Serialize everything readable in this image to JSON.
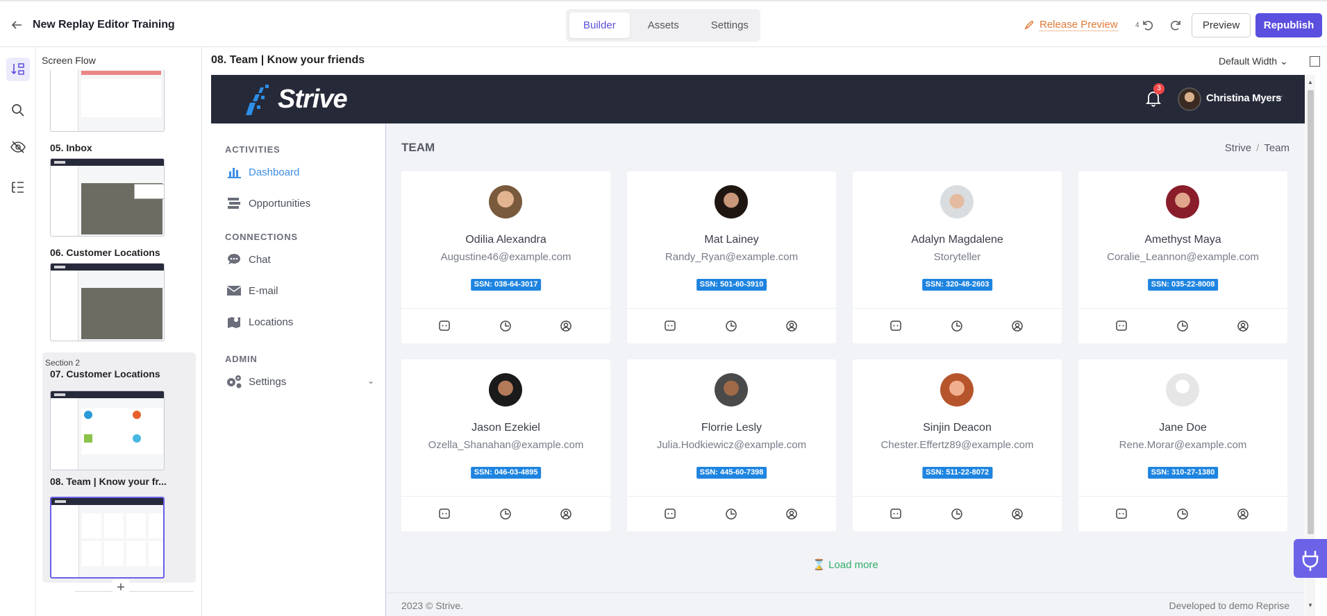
{
  "topbar": {
    "title": "New Replay Editor Training",
    "tabs": [
      "Builder",
      "Assets",
      "Settings"
    ],
    "active_tab": "Builder",
    "release_preview": "Release Preview",
    "undo_count": "4",
    "preview": "Preview",
    "republish": "Republish"
  },
  "flow": {
    "title": "Screen Flow",
    "steps": [
      {
        "label": "05. Inbox"
      },
      {
        "label": "06. Customer Locations"
      },
      {
        "label": "07. Customer Locations"
      },
      {
        "label": "08. Team | Know your fr..."
      }
    ],
    "section_label": "Section 2",
    "add": "+"
  },
  "canvas": {
    "screen_title": "08. Team | Know your friends",
    "width_select": "Default Width"
  },
  "app": {
    "logo": "Strive",
    "notifications": "3",
    "user_name": "Christina Myers",
    "nav": {
      "activities": "ACTIVITIES",
      "dashboard": "Dashboard",
      "opportunities": "Opportunities",
      "connections": "CONNECTIONS",
      "chat": "Chat",
      "email": "E-mail",
      "locations": "Locations",
      "admin": "ADMIN",
      "settings": "Settings"
    },
    "page_title": "TEAM",
    "breadcrumb": [
      "Strive",
      "Team"
    ],
    "members": [
      {
        "name": "Odilia Alexandra",
        "sub": "Augustine46@example.com",
        "ssn": "SSN: 038-64-3017"
      },
      {
        "name": "Mat Lainey",
        "sub": "Randy_Ryan@example.com",
        "ssn": "SSN: 501-60-3910"
      },
      {
        "name": "Adalyn Magdalene",
        "sub": "Storyteller",
        "ssn": "SSN: 320-48-2603"
      },
      {
        "name": "Amethyst Maya",
        "sub": "Coralie_Leannon@example.com",
        "ssn": "SSN: 035-22-8008"
      },
      {
        "name": "Jason Ezekiel",
        "sub": "Ozella_Shanahan@example.com",
        "ssn": "SSN: 046-03-4895"
      },
      {
        "name": "Florrie Lesly",
        "sub": "Julia.Hodkiewicz@example.com",
        "ssn": "SSN: 445-60-7398"
      },
      {
        "name": "Sinjin Deacon",
        "sub": "Chester.Effertz89@example.com",
        "ssn": "SSN: 511-22-8072"
      },
      {
        "name": "Jane Doe",
        "sub": "Rene.Morar@example.com",
        "ssn": "SSN: 310-27-1380"
      }
    ],
    "load_more": "Load more",
    "footer_left": "2023 © Strive.",
    "footer_right": "Developed to demo Reprise"
  },
  "colors": {
    "accent": "#5b4fe0",
    "release": "#e07a35",
    "app_header": "#262938",
    "ssn_badge": "#1e84e0",
    "nav_active": "#3c8ee3",
    "load_more": "#2fae6a"
  }
}
